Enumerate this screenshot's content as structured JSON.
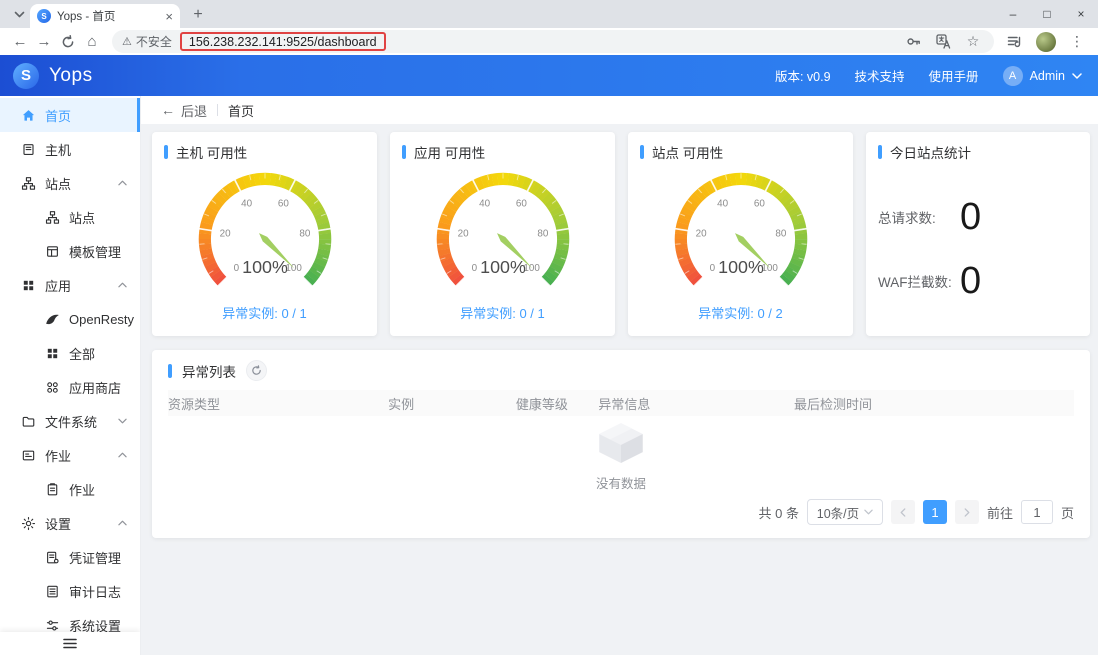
{
  "browser": {
    "tab_title": "Yops - 首页",
    "favicon_letter": "S",
    "security_label": "不安全",
    "url": "156.238.232.141:9525/dashboard"
  },
  "icons": {
    "close": "×",
    "plus": "+",
    "minimize": "–",
    "maximize": "□",
    "back": "←",
    "forward": "→",
    "home": "⌂",
    "warning": "⚠",
    "star": "☆",
    "menu_dots": "⋮"
  },
  "header": {
    "brand": "Yops",
    "logo_letter": "S",
    "version": "版本: v0.9",
    "links": [
      "技术支持",
      "使用手册"
    ],
    "avatar_letter": "A",
    "user": "Admin"
  },
  "breadcrumb": {
    "back": "后退",
    "current": "首页"
  },
  "sidebar": {
    "items": [
      {
        "id": "home",
        "label": "首页",
        "icon": "home",
        "active": true
      },
      {
        "id": "host",
        "label": "主机",
        "icon": "host"
      },
      {
        "id": "site-group",
        "label": "站点",
        "icon": "site",
        "group": true,
        "expanded": true
      },
      {
        "id": "site",
        "label": "站点",
        "icon": "site",
        "child": true
      },
      {
        "id": "template-manage",
        "label": "模板管理",
        "icon": "template",
        "child": true
      },
      {
        "id": "app-group",
        "label": "应用",
        "icon": "apps",
        "group": true,
        "expanded": true
      },
      {
        "id": "openresty",
        "label": "OpenResty",
        "icon": "openresty",
        "child": true
      },
      {
        "id": "all-apps",
        "label": "全部",
        "icon": "apps",
        "child": true
      },
      {
        "id": "app-store",
        "label": "应用商店",
        "icon": "store",
        "child": true
      },
      {
        "id": "filesystem",
        "label": "文件系统",
        "icon": "folder",
        "group": true,
        "expanded": false
      },
      {
        "id": "job-group",
        "label": "作业",
        "icon": "job",
        "group": true,
        "expanded": true
      },
      {
        "id": "job",
        "label": "作业",
        "icon": "clipboard",
        "child": true
      },
      {
        "id": "settings-group",
        "label": "设置",
        "icon": "gear",
        "group": true,
        "expanded": true
      },
      {
        "id": "credential-manage",
        "label": "凭证管理",
        "icon": "credential",
        "child": true
      },
      {
        "id": "audit-log",
        "label": "审计日志",
        "icon": "audit",
        "child": true
      },
      {
        "id": "system-settings",
        "label": "系统设置",
        "icon": "sysconfig",
        "child": true
      }
    ]
  },
  "chart_data": [
    {
      "type": "gauge",
      "id": "host",
      "title": "主机 可用性",
      "value": 100,
      "unit": "%",
      "min": 0,
      "max": 100,
      "tick_interval": 20,
      "ticks": [
        0,
        20,
        40,
        60,
        80,
        100
      ],
      "footer_label": "异常实例:",
      "footer_value": "0 / 1"
    },
    {
      "type": "gauge",
      "id": "app",
      "title": "应用 可用性",
      "value": 100,
      "unit": "%",
      "min": 0,
      "max": 100,
      "tick_interval": 20,
      "ticks": [
        0,
        20,
        40,
        60,
        80,
        100
      ],
      "footer_label": "异常实例:",
      "footer_value": "0 / 1"
    },
    {
      "type": "gauge",
      "id": "site",
      "title": "站点 可用性",
      "value": 100,
      "unit": "%",
      "min": 0,
      "max": 100,
      "tick_interval": 20,
      "ticks": [
        0,
        20,
        40,
        60,
        80,
        100
      ],
      "footer_label": "异常实例:",
      "footer_value": "0 / 2"
    }
  ],
  "stats_card": {
    "title": "今日站点统计",
    "items": [
      {
        "label": "总请求数:",
        "value": "0"
      },
      {
        "label": "WAF拦截数:",
        "value": "0"
      }
    ]
  },
  "exception_table": {
    "title": "异常列表",
    "columns": [
      "资源类型",
      "实例",
      "健康等级",
      "异常信息",
      "最后检测时间"
    ],
    "rows": [],
    "empty_text": "没有数据",
    "pagination": {
      "total_label": "共 0 条",
      "page_size": "10条/页",
      "current_page": "1",
      "goto_label": "前往",
      "goto_value": "1",
      "page_suffix": "页"
    }
  },
  "colors": {
    "accent": "#409eff",
    "header_gradient_start": "#1c4ed3",
    "header_gradient_end": "#2f85f3",
    "annotation_red": "#e04343",
    "gauge_stops": [
      "#f04e3e",
      "#fa9e1b",
      "#f4d80a",
      "#9ecb3a",
      "#46af52"
    ]
  }
}
